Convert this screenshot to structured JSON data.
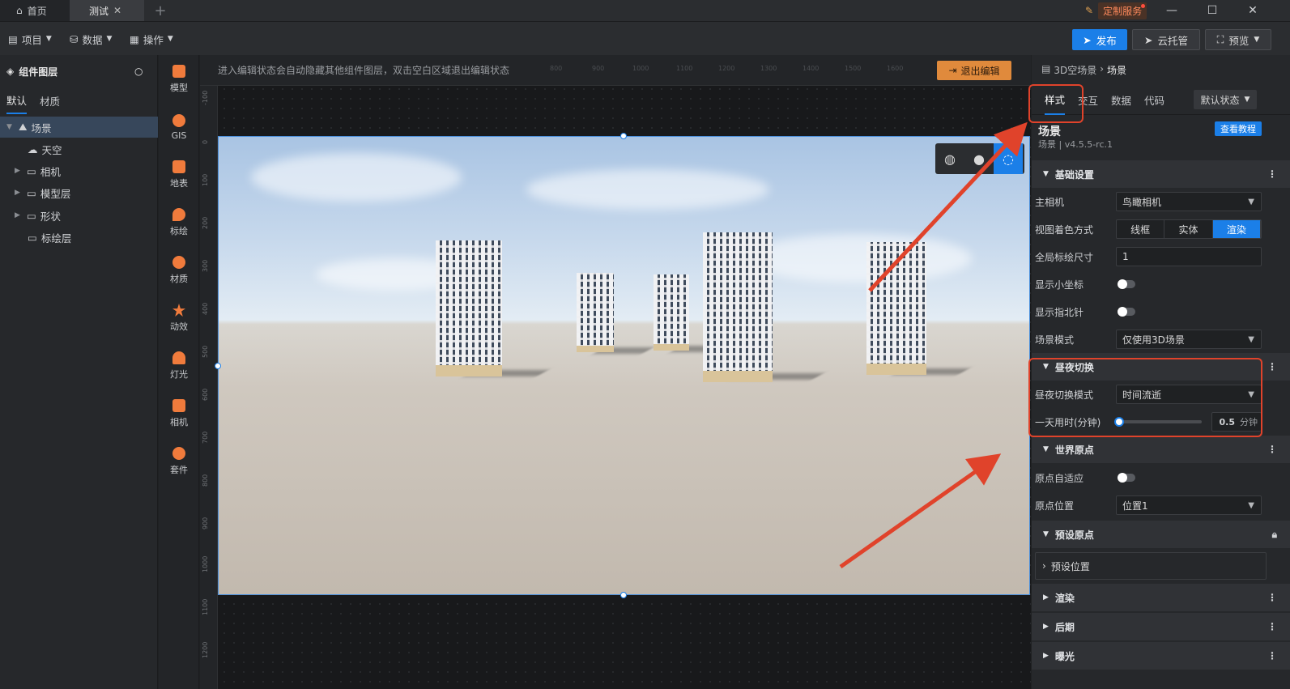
{
  "tabs": [
    {
      "label": "首页",
      "icon": "home-icon"
    },
    {
      "label": "测试",
      "icon": "close-icon"
    }
  ],
  "window": {
    "custom_service": "定制服务"
  },
  "menubar": {
    "items": [
      {
        "label": "项目"
      },
      {
        "label": "数据"
      },
      {
        "label": "操作"
      }
    ],
    "publish": "发布",
    "cloud": "云托管",
    "preview": "预览"
  },
  "layers": {
    "title": "组件图层",
    "tabs": [
      "默认",
      "材质"
    ],
    "tree": [
      {
        "label": "场景",
        "expanded": true,
        "selected": true
      },
      {
        "label": "天空",
        "expanded": null
      },
      {
        "label": "相机",
        "expanded": false
      },
      {
        "label": "模型层",
        "expanded": false
      },
      {
        "label": "形状",
        "expanded": false
      },
      {
        "label": "标绘层",
        "expanded": null
      }
    ]
  },
  "toolbar": {
    "items": [
      {
        "label": "模型",
        "icon": "model-icon"
      },
      {
        "label": "GIS",
        "icon": "gis-icon"
      },
      {
        "label": "地表",
        "icon": "terrain-icon"
      },
      {
        "label": "标绘",
        "icon": "marker-icon"
      },
      {
        "label": "材质",
        "icon": "material-icon"
      },
      {
        "label": "动效",
        "icon": "effect-icon"
      },
      {
        "label": "灯光",
        "icon": "light-icon"
      },
      {
        "label": "相机",
        "icon": "camera-icon"
      },
      {
        "label": "套件",
        "icon": "kit-icon"
      }
    ]
  },
  "canvas": {
    "hint": "进入编辑状态会自动隐藏其他组件图层，双击空白区域退出编辑状态",
    "exit_edit": "退出编辑",
    "ruler_top": [
      "800",
      "900",
      "1000",
      "1100",
      "1200",
      "1300",
      "1400",
      "1500",
      "1600"
    ],
    "ruler_left": [
      "-100",
      "0",
      "100",
      "200",
      "300",
      "400",
      "500",
      "600",
      "700",
      "800",
      "900",
      "1000",
      "1100",
      "1200"
    ]
  },
  "props": {
    "breadcrumb": [
      "3D空场景",
      "场景"
    ],
    "tabs": [
      "样式",
      "交互",
      "数据",
      "代码"
    ],
    "state": "默认状态",
    "component_title": "场景",
    "component_version": "场景 | v4.5.5-rc.1",
    "tutorial": "查看教程",
    "sections": {
      "basic": "基础设置",
      "daynight": "昼夜切换",
      "world_origin": "世界原点",
      "preset_origin": "预设原点",
      "render": "渲染",
      "post": "后期",
      "exposure": "曝光"
    },
    "main_camera": {
      "label": "主相机",
      "value": "鸟瞰相机"
    },
    "view_shading": {
      "label": "视图着色方式",
      "options": [
        "线框",
        "实体",
        "渲染"
      ],
      "selected": "渲染"
    },
    "global_marker_size": {
      "label": "全局标绘尺寸",
      "value": "1"
    },
    "show_small_axis": {
      "label": "显示小坐标",
      "on": false
    },
    "show_compass": {
      "label": "显示指北针",
      "on": false
    },
    "scene_mode": {
      "label": "场景模式",
      "value": "仅使用3D场景"
    },
    "daynight_mode": {
      "label": "昼夜切换模式",
      "value": "时间流逝"
    },
    "day_duration": {
      "label": "一天用时(分钟)",
      "value": "0.5",
      "unit": "分钟",
      "level": 0
    },
    "origin_adaptive": {
      "label": "原点自适应",
      "on": false
    },
    "origin_position": {
      "label": "原点位置",
      "value": "位置1"
    },
    "preset_position": "预设位置"
  },
  "colors": {
    "accent": "#1b7fe8",
    "annotation": "#e0432b",
    "exit_button": "#e08a3c"
  }
}
